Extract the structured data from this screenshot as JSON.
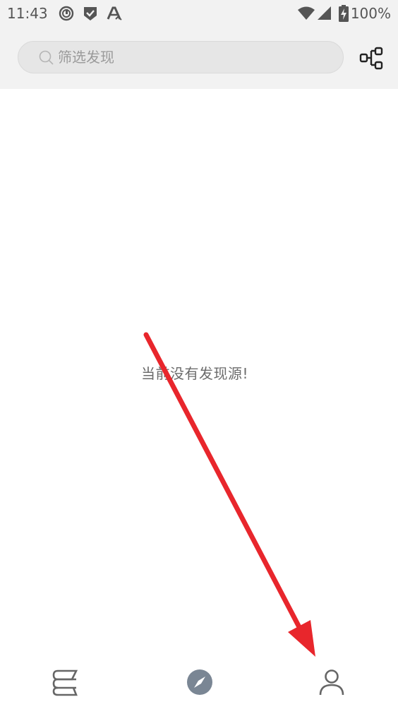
{
  "status_bar": {
    "time": "11:43",
    "battery": "100%",
    "icons": [
      "music-app-icon",
      "shield-check-icon",
      "translate-a-icon",
      "wifi-icon",
      "signal-icon",
      "battery-charging-icon"
    ]
  },
  "header": {
    "search": {
      "placeholder": "筛选发现",
      "value": ""
    },
    "tree_icon": "node-tree-icon"
  },
  "main": {
    "empty_message": "当前没有发现源!"
  },
  "bottom_nav": {
    "items": [
      {
        "icon": "bookshelf-icon",
        "active": false
      },
      {
        "icon": "compass-icon",
        "active": true
      },
      {
        "icon": "person-icon",
        "active": false
      }
    ]
  },
  "annotation": {
    "arrow_color": "#e8262c"
  },
  "colors": {
    "header_bg": "#f2f2f2",
    "search_bg": "#e6e6e6",
    "nav_icon": "#666666",
    "nav_active": "#7a8694"
  }
}
